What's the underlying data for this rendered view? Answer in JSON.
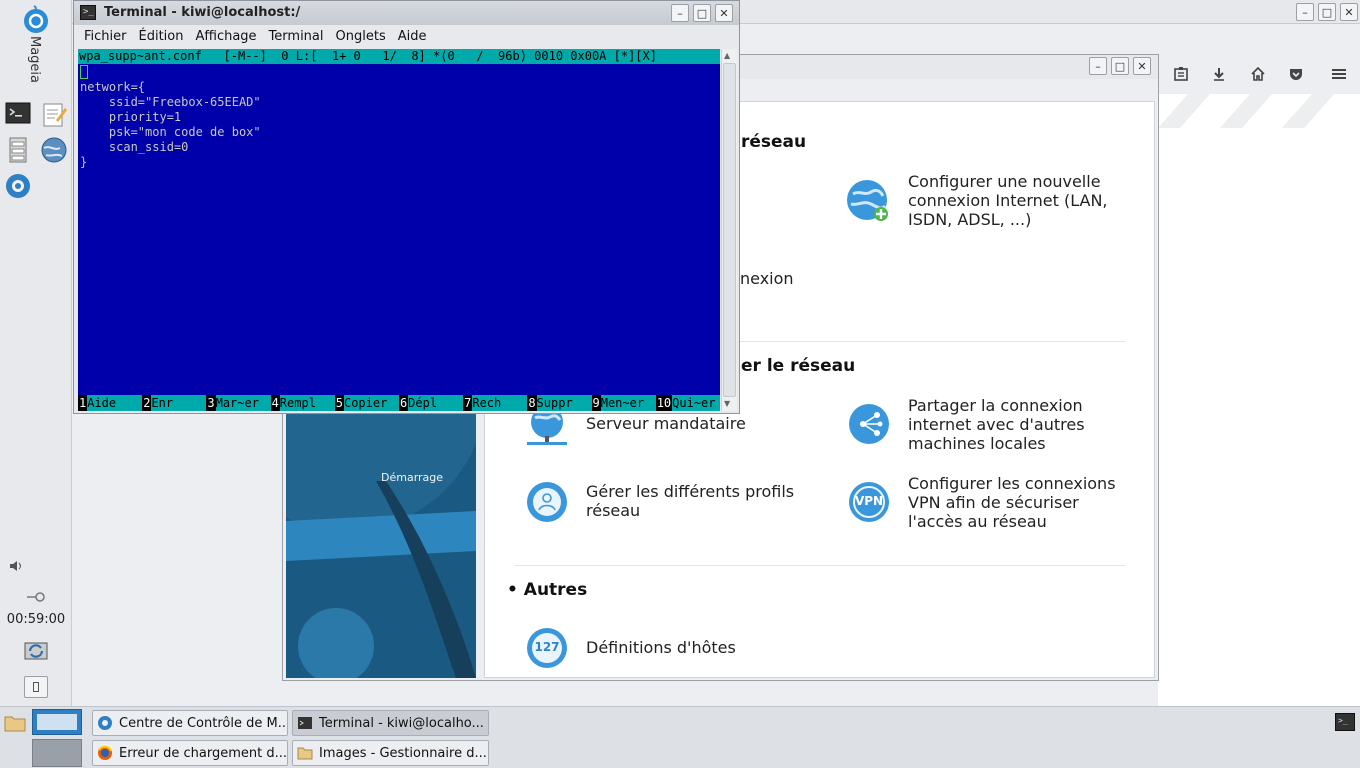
{
  "left_panel": {
    "brand": "Mageia",
    "clock": "00:59:00",
    "launchers": [
      "terminal-icon",
      "text-editor-icon",
      "file-manager-icon",
      "network-globe-icon",
      "control-center-icon"
    ]
  },
  "mcc": {
    "sidebar_label": "Démarrage",
    "sections": [
      {
        "title": "réseau"
      },
      {
        "title": "er le réseau"
      },
      {
        "title": "• Autres"
      }
    ],
    "items": {
      "new_connection": "Configurer une nouvelle connexion Internet (LAN, ISDN, ADSL, ...)",
      "connection_partial": "nexion",
      "share": "Partager la connexion internet avec d'autres machines locales",
      "proxy": "Serveur mandataire",
      "profiles": "Gérer les différents profils réseau",
      "vpn": "Configurer les connexions VPN afin de sécuriser l'accès au réseau",
      "hosts": "Définitions d'hôtes",
      "hosts_badge": "127",
      "vpn_badge": "VPN"
    }
  },
  "terminal": {
    "title": "Terminal - kiwi@localhost:/",
    "menu": [
      "Fichier",
      "Édition",
      "Affichage",
      "Terminal",
      "Onglets",
      "Aide"
    ],
    "status_line": "wpa_supp~ant.conf   [-M--]  0 L:[  1+ 0   1/  8] *(0   /  96b) 0010 0x00A [*][X]",
    "lines": [
      "",
      "network={",
      "    ssid=\"Freebox-65EEAD\"",
      "    priority=1",
      "    psk=\"mon code de box\"",
      "    scan_ssid=0",
      "}"
    ],
    "fkeys": [
      {
        "n": "1",
        "l": "Aide"
      },
      {
        "n": "2",
        "l": "Enr"
      },
      {
        "n": "3",
        "l": "Mar~er"
      },
      {
        "n": "4",
        "l": "Rempl"
      },
      {
        "n": "5",
        "l": "Copier"
      },
      {
        "n": "6",
        "l": "Dépl"
      },
      {
        "n": "7",
        "l": "Rech"
      },
      {
        "n": "8",
        "l": "Suppr"
      },
      {
        "n": "9",
        "l": "Men~er"
      },
      {
        "n": "10",
        "l": "Qui~er"
      }
    ]
  },
  "taskbar": {
    "tasks": [
      {
        "label": "Centre de Contrôle de M...",
        "icon": "control-center-icon",
        "active": false
      },
      {
        "label": "Terminal - kiwi@localho...",
        "icon": "terminal-icon",
        "active": true
      },
      {
        "label": "Erreur de chargement d...",
        "icon": "firefox-icon",
        "active": false
      },
      {
        "label": "Images - Gestionnaire d...",
        "icon": "folder-icon",
        "active": false
      }
    ]
  }
}
